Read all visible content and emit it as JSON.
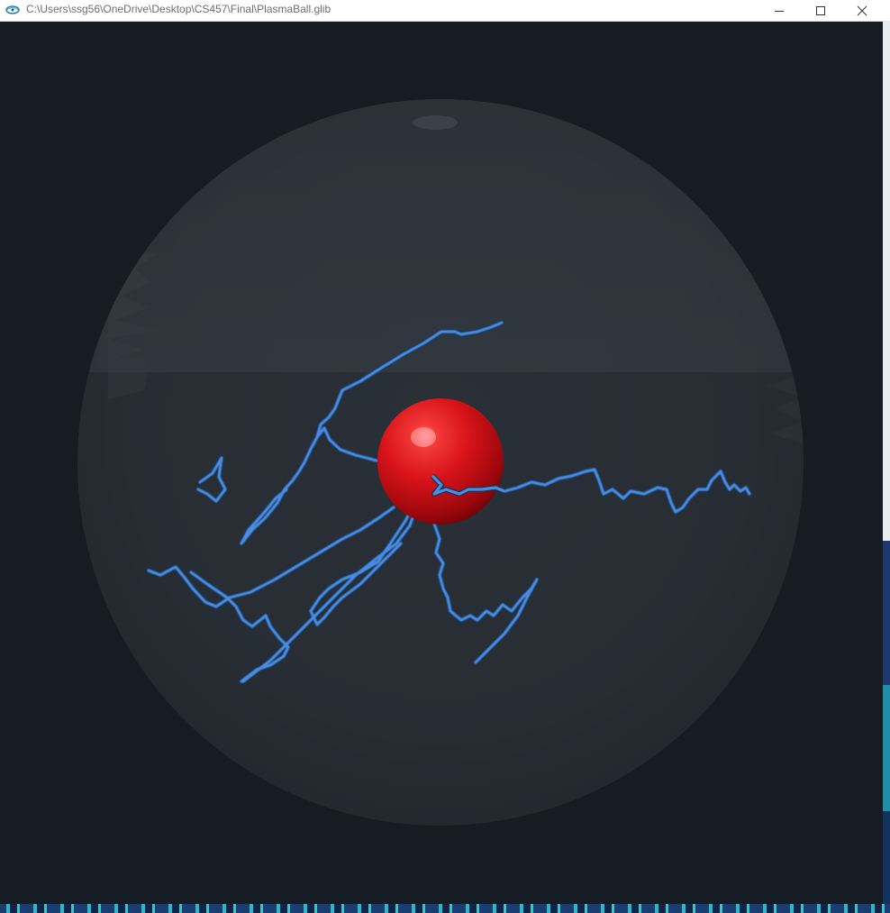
{
  "window": {
    "title": "C:\\Users\\ssg56\\OneDrive\\Desktop\\CS457\\Final\\PlasmaBall.glib",
    "icon": "glib-app-icon"
  },
  "titlebar_buttons": {
    "minimize": "minimize-icon",
    "maximize": "maximize-icon",
    "close": "close-icon"
  },
  "scene": {
    "background_color": "#161c24",
    "globe_color": "#2b3138",
    "electrode_color": "#d4141a",
    "lightning_color": "#4a8de2"
  }
}
